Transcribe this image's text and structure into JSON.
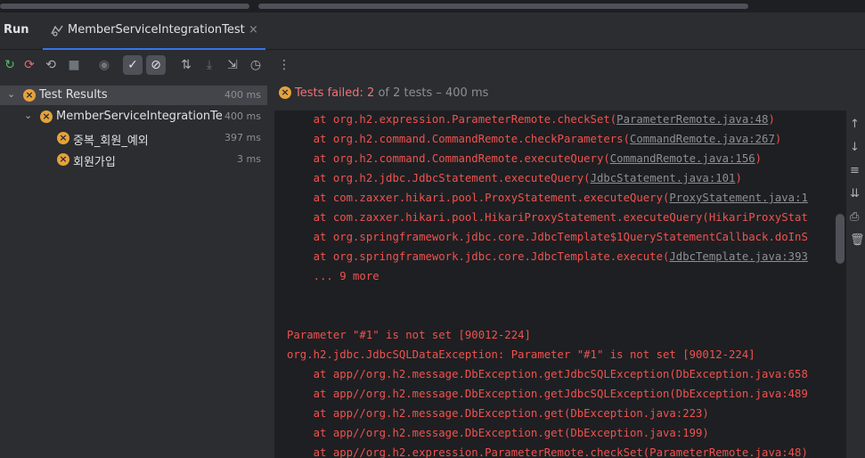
{
  "window": {
    "tool_window_title": "Run",
    "tab_label": "MemberServiceIntegrationTest"
  },
  "toolbar": {
    "icons": [
      "rerun-icon",
      "rerun-failed-icon",
      "toggle-auto-test-icon",
      "stop-icon",
      "show-passed-icon",
      "show-ignored-icon",
      "hide-ignored-icon",
      "sort-icon",
      "import-tests-icon",
      "export-icon",
      "history-icon",
      "more-options-icon"
    ]
  },
  "tree": {
    "root": {
      "label": "Test Results",
      "time": "400 ms",
      "status": "failed"
    },
    "suite": {
      "label": "MemberServiceIntegrationTest",
      "time": "400 ms",
      "status": "failed"
    },
    "tests": [
      {
        "label": "중복_회원_예외",
        "time": "397 ms",
        "status": "failed"
      },
      {
        "label": "회원가입",
        "time": "3 ms",
        "status": "failed"
      }
    ]
  },
  "status_bar": {
    "failed_text": "Tests failed: 2",
    "rest_text": " of 2 tests – 400 ms"
  },
  "console": {
    "lines": [
      {
        "pre": "    at org.h2.expression.ParameterRemote.checkSet(",
        "link": "ParameterRemote.java:48",
        "post": ")"
      },
      {
        "pre": "    at org.h2.command.CommandRemote.checkParameters(",
        "link": "CommandRemote.java:267",
        "post": ")"
      },
      {
        "pre": "    at org.h2.command.CommandRemote.executeQuery(",
        "link": "CommandRemote.java:156",
        "post": ")"
      },
      {
        "pre": "    at org.h2.jdbc.JdbcStatement.executeQuery(",
        "link": "JdbcStatement.java:101",
        "post": ")"
      },
      {
        "pre": "    at com.zaxxer.hikari.pool.ProxyStatement.executeQuery(",
        "link": "ProxyStatement.java:1",
        "post": ""
      },
      {
        "pre": "    at com.zaxxer.hikari.pool.HikariProxyStatement.executeQuery(HikariProxyStat",
        "link": "",
        "post": ""
      },
      {
        "pre": "    at org.springframework.jdbc.core.JdbcTemplate$1QueryStatementCallback.doInS",
        "link": "",
        "post": ""
      },
      {
        "pre": "    at org.springframework.jdbc.core.JdbcTemplate.execute(",
        "link": "JdbcTemplate.java:393",
        "post": ""
      },
      {
        "pre": "    ... 9 more",
        "link": "",
        "post": ""
      },
      {
        "pre": "",
        "link": "",
        "post": ""
      },
      {
        "pre": "",
        "link": "",
        "post": ""
      },
      {
        "pre": "Parameter \"#1\" is not set [90012-224]",
        "link": "",
        "post": ""
      },
      {
        "pre": "org.h2.jdbc.JdbcSQLDataException: Parameter \"#1\" is not set [90012-224]",
        "link": "",
        "post": ""
      },
      {
        "pre": "    at app//org.h2.message.DbException.getJdbcSQLException(DbException.java:658",
        "link": "",
        "post": ""
      },
      {
        "pre": "    at app//org.h2.message.DbException.getJdbcSQLException(DbException.java:489",
        "link": "",
        "post": ""
      },
      {
        "pre": "    at app//org.h2.message.DbException.get(DbException.java:223)",
        "link": "",
        "post": ""
      },
      {
        "pre": "    at app//org.h2.message.DbException.get(DbException.java:199)",
        "link": "",
        "post": ""
      },
      {
        "pre": "    at app//org.h2.expression.ParameterRemote.checkSet(ParameterRemote.java:48)",
        "link": "",
        "post": ""
      }
    ]
  },
  "colors": {
    "error_text": "#f0524f",
    "accent": "#3574f0",
    "fail_icon": "#e5a23c",
    "pass_icon": "#5fb865"
  },
  "right_strip_icons": [
    "up-arrow-icon",
    "down-arrow-icon",
    "soft-wrap-icon",
    "scroll-to-end-icon",
    "print-icon",
    "trash-icon"
  ]
}
